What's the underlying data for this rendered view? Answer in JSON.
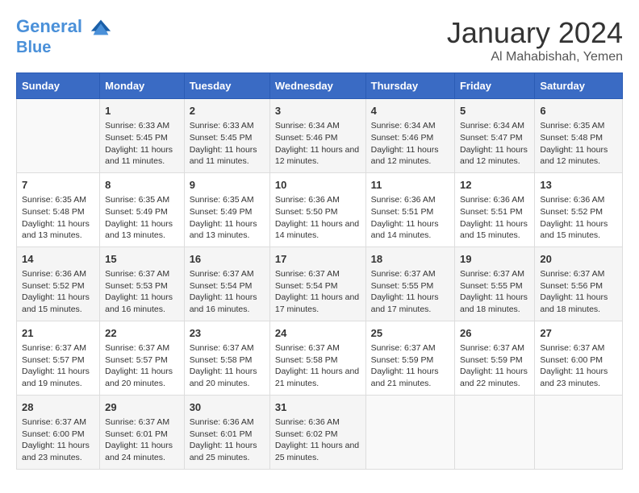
{
  "logo": {
    "line1": "General",
    "line2": "Blue"
  },
  "title": "January 2024",
  "subtitle": "Al Mahabishah, Yemen",
  "headers": [
    "Sunday",
    "Monday",
    "Tuesday",
    "Wednesday",
    "Thursday",
    "Friday",
    "Saturday"
  ],
  "weeks": [
    [
      {
        "day": "",
        "info": ""
      },
      {
        "day": "1",
        "info": "Sunrise: 6:33 AM\nSunset: 5:45 PM\nDaylight: 11 hours and 11 minutes."
      },
      {
        "day": "2",
        "info": "Sunrise: 6:33 AM\nSunset: 5:45 PM\nDaylight: 11 hours and 11 minutes."
      },
      {
        "day": "3",
        "info": "Sunrise: 6:34 AM\nSunset: 5:46 PM\nDaylight: 11 hours and 12 minutes."
      },
      {
        "day": "4",
        "info": "Sunrise: 6:34 AM\nSunset: 5:46 PM\nDaylight: 11 hours and 12 minutes."
      },
      {
        "day": "5",
        "info": "Sunrise: 6:34 AM\nSunset: 5:47 PM\nDaylight: 11 hours and 12 minutes."
      },
      {
        "day": "6",
        "info": "Sunrise: 6:35 AM\nSunset: 5:48 PM\nDaylight: 11 hours and 12 minutes."
      }
    ],
    [
      {
        "day": "7",
        "info": "Sunrise: 6:35 AM\nSunset: 5:48 PM\nDaylight: 11 hours and 13 minutes."
      },
      {
        "day": "8",
        "info": "Sunrise: 6:35 AM\nSunset: 5:49 PM\nDaylight: 11 hours and 13 minutes."
      },
      {
        "day": "9",
        "info": "Sunrise: 6:35 AM\nSunset: 5:49 PM\nDaylight: 11 hours and 13 minutes."
      },
      {
        "day": "10",
        "info": "Sunrise: 6:36 AM\nSunset: 5:50 PM\nDaylight: 11 hours and 14 minutes."
      },
      {
        "day": "11",
        "info": "Sunrise: 6:36 AM\nSunset: 5:51 PM\nDaylight: 11 hours and 14 minutes."
      },
      {
        "day": "12",
        "info": "Sunrise: 6:36 AM\nSunset: 5:51 PM\nDaylight: 11 hours and 15 minutes."
      },
      {
        "day": "13",
        "info": "Sunrise: 6:36 AM\nSunset: 5:52 PM\nDaylight: 11 hours and 15 minutes."
      }
    ],
    [
      {
        "day": "14",
        "info": "Sunrise: 6:36 AM\nSunset: 5:52 PM\nDaylight: 11 hours and 15 minutes."
      },
      {
        "day": "15",
        "info": "Sunrise: 6:37 AM\nSunset: 5:53 PM\nDaylight: 11 hours and 16 minutes."
      },
      {
        "day": "16",
        "info": "Sunrise: 6:37 AM\nSunset: 5:54 PM\nDaylight: 11 hours and 16 minutes."
      },
      {
        "day": "17",
        "info": "Sunrise: 6:37 AM\nSunset: 5:54 PM\nDaylight: 11 hours and 17 minutes."
      },
      {
        "day": "18",
        "info": "Sunrise: 6:37 AM\nSunset: 5:55 PM\nDaylight: 11 hours and 17 minutes."
      },
      {
        "day": "19",
        "info": "Sunrise: 6:37 AM\nSunset: 5:55 PM\nDaylight: 11 hours and 18 minutes."
      },
      {
        "day": "20",
        "info": "Sunrise: 6:37 AM\nSunset: 5:56 PM\nDaylight: 11 hours and 18 minutes."
      }
    ],
    [
      {
        "day": "21",
        "info": "Sunrise: 6:37 AM\nSunset: 5:57 PM\nDaylight: 11 hours and 19 minutes."
      },
      {
        "day": "22",
        "info": "Sunrise: 6:37 AM\nSunset: 5:57 PM\nDaylight: 11 hours and 20 minutes."
      },
      {
        "day": "23",
        "info": "Sunrise: 6:37 AM\nSunset: 5:58 PM\nDaylight: 11 hours and 20 minutes."
      },
      {
        "day": "24",
        "info": "Sunrise: 6:37 AM\nSunset: 5:58 PM\nDaylight: 11 hours and 21 minutes."
      },
      {
        "day": "25",
        "info": "Sunrise: 6:37 AM\nSunset: 5:59 PM\nDaylight: 11 hours and 21 minutes."
      },
      {
        "day": "26",
        "info": "Sunrise: 6:37 AM\nSunset: 5:59 PM\nDaylight: 11 hours and 22 minutes."
      },
      {
        "day": "27",
        "info": "Sunrise: 6:37 AM\nSunset: 6:00 PM\nDaylight: 11 hours and 23 minutes."
      }
    ],
    [
      {
        "day": "28",
        "info": "Sunrise: 6:37 AM\nSunset: 6:00 PM\nDaylight: 11 hours and 23 minutes."
      },
      {
        "day": "29",
        "info": "Sunrise: 6:37 AM\nSunset: 6:01 PM\nDaylight: 11 hours and 24 minutes."
      },
      {
        "day": "30",
        "info": "Sunrise: 6:36 AM\nSunset: 6:01 PM\nDaylight: 11 hours and 25 minutes."
      },
      {
        "day": "31",
        "info": "Sunrise: 6:36 AM\nSunset: 6:02 PM\nDaylight: 11 hours and 25 minutes."
      },
      {
        "day": "",
        "info": ""
      },
      {
        "day": "",
        "info": ""
      },
      {
        "day": "",
        "info": ""
      }
    ]
  ]
}
